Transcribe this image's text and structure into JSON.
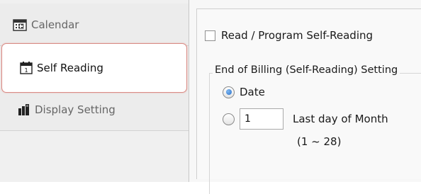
{
  "sidebar": {
    "tabs": [
      {
        "label": "Calendar",
        "icon": "calendar-icon",
        "selected": false
      },
      {
        "label": "Self Reading",
        "icon": "calendar-day-icon",
        "selected": true
      },
      {
        "label": "Display Setting",
        "icon": "display-setting-icon",
        "selected": false
      }
    ],
    "selected_outline_color": "#d98b85"
  },
  "panel": {
    "read_program_checkbox": {
      "label": "Read / Program Self-Reading",
      "checked": false
    },
    "group_title": "End of Billing (Self-Reading) Setting",
    "radio_date": {
      "label": "Date",
      "selected": true
    },
    "radio_last_day": {
      "selected": false
    },
    "day_input": {
      "value": "1"
    },
    "last_day_label": "Last day of Month",
    "range_label": "(1 ~ 28)"
  }
}
